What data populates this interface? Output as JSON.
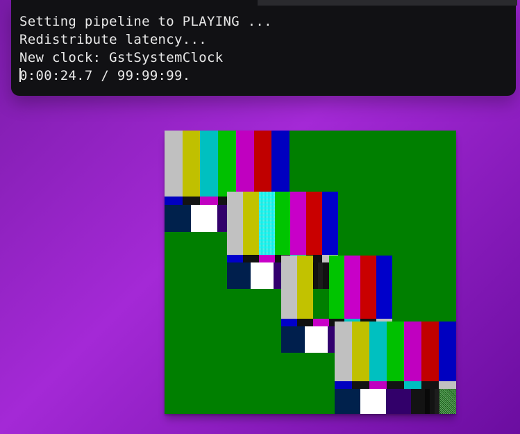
{
  "terminal": {
    "lines": [
      "Setting pipeline to PLAYING ...",
      "Redistribute latency...",
      "New clock: GstSystemClock",
      "0:00:24.7 / 99:99:99."
    ]
  },
  "video": {
    "bg": "#007f00",
    "smpte_bars": [
      "#c0c0c0",
      "#c0c000",
      "#00c0c0",
      "#00c000",
      "#c000c0",
      "#c00000",
      "#0000c0"
    ],
    "smpte_mid": [
      "#0000c0",
      "#131313",
      "#c000c0",
      "#131313",
      "#00c0c0",
      "#131313",
      "#c0c0c0"
    ],
    "smpte_low_widths": [
      21,
      21,
      21,
      11,
      4,
      4,
      4,
      14
    ],
    "smpte_low_colors": [
      "#00214c",
      "#ffffff",
      "#32006a",
      "#131313",
      "#090909",
      "#131313",
      "#1d1d1d",
      "#131313"
    ]
  }
}
